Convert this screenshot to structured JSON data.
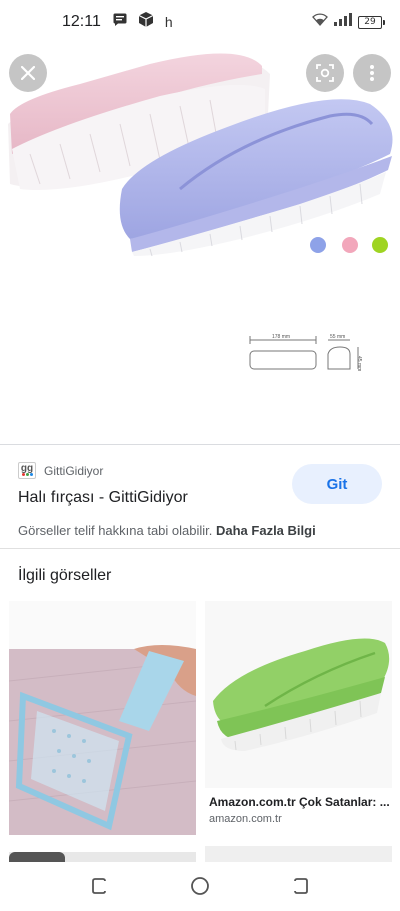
{
  "status_bar": {
    "time": "12:11",
    "extra": "h",
    "battery": "29",
    "icons": [
      "message-icon",
      "package-icon",
      "wifi-icon",
      "signal-icon",
      "battery-icon"
    ]
  },
  "viewer": {
    "buttons": [
      "close-icon",
      "lens-icon",
      "more-vert-icon"
    ],
    "color_options": [
      "#8ea2e8",
      "#f2a7bb",
      "#9fd422"
    ],
    "dimension_labels": {
      "length": "178 mm",
      "width": "55 mm",
      "height": "45 mm"
    }
  },
  "result": {
    "site_name": "GittiGidiyor",
    "site_logo": "gg",
    "title": "Halı fırçası - GittiGidiyor",
    "visit_button": "Git",
    "copyright_text": "Görseller telif hakkına tabi olabilir.",
    "more_info_link": "Daha Fazla Bilgi"
  },
  "related": {
    "heading": "İlgili görseller",
    "items": [
      {
        "source": "",
        "domain": ""
      },
      {
        "source": "Amazon.com.tr Çok Satanlar: ...",
        "domain": "amazon.com.tr"
      }
    ]
  },
  "nav_bar": {
    "buttons": [
      "recent-apps-icon",
      "home-icon",
      "back-icon"
    ]
  },
  "colors": {
    "accent": "#1a73e8",
    "button_bg": "#e8f0fe",
    "brush_blue": "#aeb4ea",
    "brush_pink": "#ecc6d2",
    "brush_green": "#8fd46a"
  }
}
